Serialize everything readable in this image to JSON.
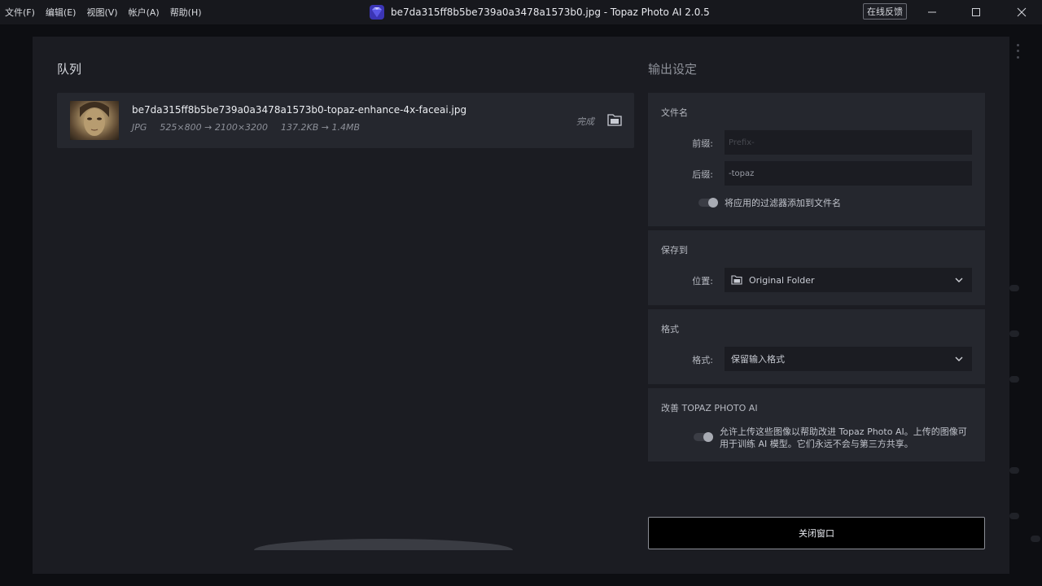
{
  "menu": {
    "items": [
      "文件(F)",
      "编辑(E)",
      "视图(V)",
      "帐户(A)",
      "帮助(H)"
    ]
  },
  "window": {
    "title": "be7da315ff8b5be739a0a3478a1573b0.jpg - Topaz Photo AI 2.0.5",
    "feedback_label": "在线反馈",
    "controls": [
      "minimize-icon",
      "maximize-icon",
      "close-icon"
    ]
  },
  "queue": {
    "title": "队列",
    "items": [
      {
        "file_name": "be7da315ff8b5be739a0a3478a1573b0-topaz-enhance-4x-faceai.jpg",
        "format": "JPG",
        "resolution": "525×800 → 2100×3200",
        "size": "137.2KB → 1.4MB",
        "status": "完成",
        "icon": "folder-open-icon"
      }
    ]
  },
  "output": {
    "title": "输出设定",
    "filename": {
      "label": "文件名",
      "prefix_label": "前缀:",
      "prefix_placeholder": "Prefix-",
      "prefix_value": "",
      "suffix_label": "后缀:",
      "suffix_value": "-topaz",
      "toggle_label": "将应用的过滤器添加到文件名"
    },
    "save_to": {
      "label": "保存到",
      "location_label": "位置:",
      "location_value": "Original Folder"
    },
    "format": {
      "label": "格式",
      "format_label": "格式:",
      "format_value": "保留输入格式"
    },
    "improve": {
      "label": "改善 TOPAZ PHOTO AI",
      "text_line1": "允许上传这些图像以帮助改进 Topaz Photo AI。上传的图像可",
      "text_line2": "用于训练 AI 模型。它们永远不会与第三方共享。"
    },
    "close_button": "关闭窗口"
  },
  "colors": {
    "background": "#0b0c10",
    "modal": "#1b1c22",
    "panel": "#25272e",
    "accent": "#6e6cf0"
  }
}
